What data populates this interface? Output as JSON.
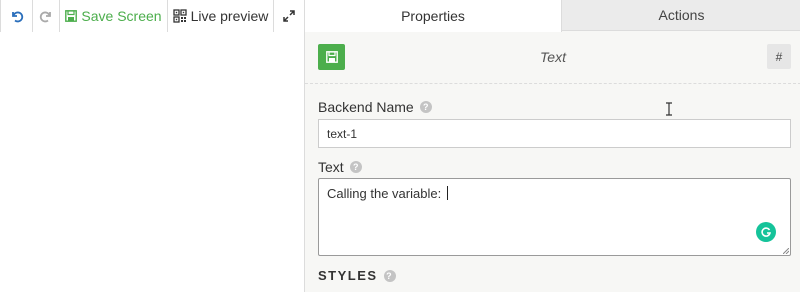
{
  "toolbar": {
    "save_label": "Save Screen",
    "live_label": "Live preview"
  },
  "tabs": {
    "properties": "Properties",
    "actions": "Actions"
  },
  "component": {
    "type": "Text",
    "hash": "#"
  },
  "fields": {
    "backend_name_label": "Backend Name",
    "backend_name_value": "text-1",
    "text_label": "Text",
    "text_value": "Calling the variable: "
  },
  "section": {
    "styles_label": "STYLES"
  },
  "colors": {
    "accent_green": "#4cae4c",
    "grammarly": "#15c39a"
  },
  "icons": [
    "undo-icon",
    "redo-icon",
    "save-icon",
    "qr-icon",
    "expand-icon",
    "help-icon",
    "grammarly-icon",
    "text-cursor-icon"
  ]
}
